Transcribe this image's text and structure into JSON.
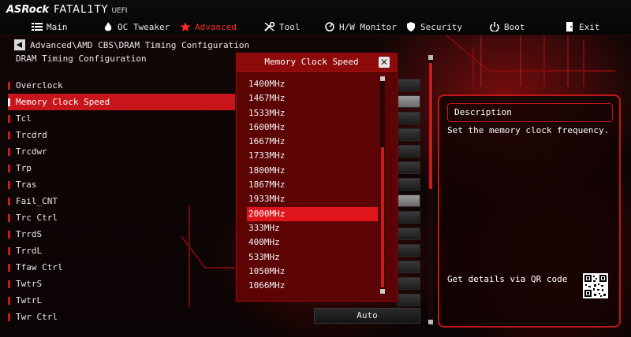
{
  "brand": {
    "name": "ASRock",
    "series": "FATAL1TY",
    "suffix": "UEFI"
  },
  "nav": [
    {
      "label": "Main",
      "icon": "menu-list-icon",
      "active": false
    },
    {
      "label": "OC Tweaker",
      "icon": "flame-icon",
      "active": false
    },
    {
      "label": "Advanced",
      "icon": "star-icon",
      "active": true
    },
    {
      "label": "Tool",
      "icon": "wrench-icon",
      "active": false
    },
    {
      "label": "H/W Monitor",
      "icon": "monitor-gauge-icon",
      "active": false
    },
    {
      "label": "Security",
      "icon": "shield-icon",
      "active": false
    },
    {
      "label": "Boot",
      "icon": "power-icon",
      "active": false
    },
    {
      "label": "Exit",
      "icon": "exit-door-icon",
      "active": false
    }
  ],
  "breadcrumb": "Advanced\\AMD CBS\\DRAM Timing Configuration",
  "subtitle": "DRAM Timing Configuration",
  "menu": [
    {
      "label": "Overclock"
    },
    {
      "label": "Memory Clock Speed",
      "selected": true
    },
    {
      "label": "Tcl"
    },
    {
      "label": "Trcdrd"
    },
    {
      "label": "Trcdwr"
    },
    {
      "label": "Trp"
    },
    {
      "label": "Tras"
    },
    {
      "label": "Fail_CNT"
    },
    {
      "label": "Trc Ctrl"
    },
    {
      "label": "TrrdS"
    },
    {
      "label": "TrrdL"
    },
    {
      "label": "Tfaw Ctrl"
    },
    {
      "label": "TwtrS"
    },
    {
      "label": "TwtrL"
    },
    {
      "label": "Twr Ctrl"
    }
  ],
  "values": {
    "auto_faded": "Auto",
    "auto_bottom": "Auto"
  },
  "popup": {
    "title": "Memory Clock Speed",
    "options": [
      "1400MHz",
      "1467MHz",
      "1533MHz",
      "1600MHz",
      "1667MHz",
      "1733MHz",
      "1800MHz",
      "1867MHz",
      "1933MHz",
      "2000MHz",
      "333MHz",
      "400MHz",
      "533MHz",
      "1050MHz",
      "1066MHz"
    ],
    "selected_index": 9
  },
  "description": {
    "header": "Description",
    "text": "Set the memory clock frequency.",
    "qr_label": "Get details via QR code"
  },
  "colors": {
    "accent": "#d01818",
    "selected": "#e0151b",
    "popup_bg": "#5c0404"
  }
}
